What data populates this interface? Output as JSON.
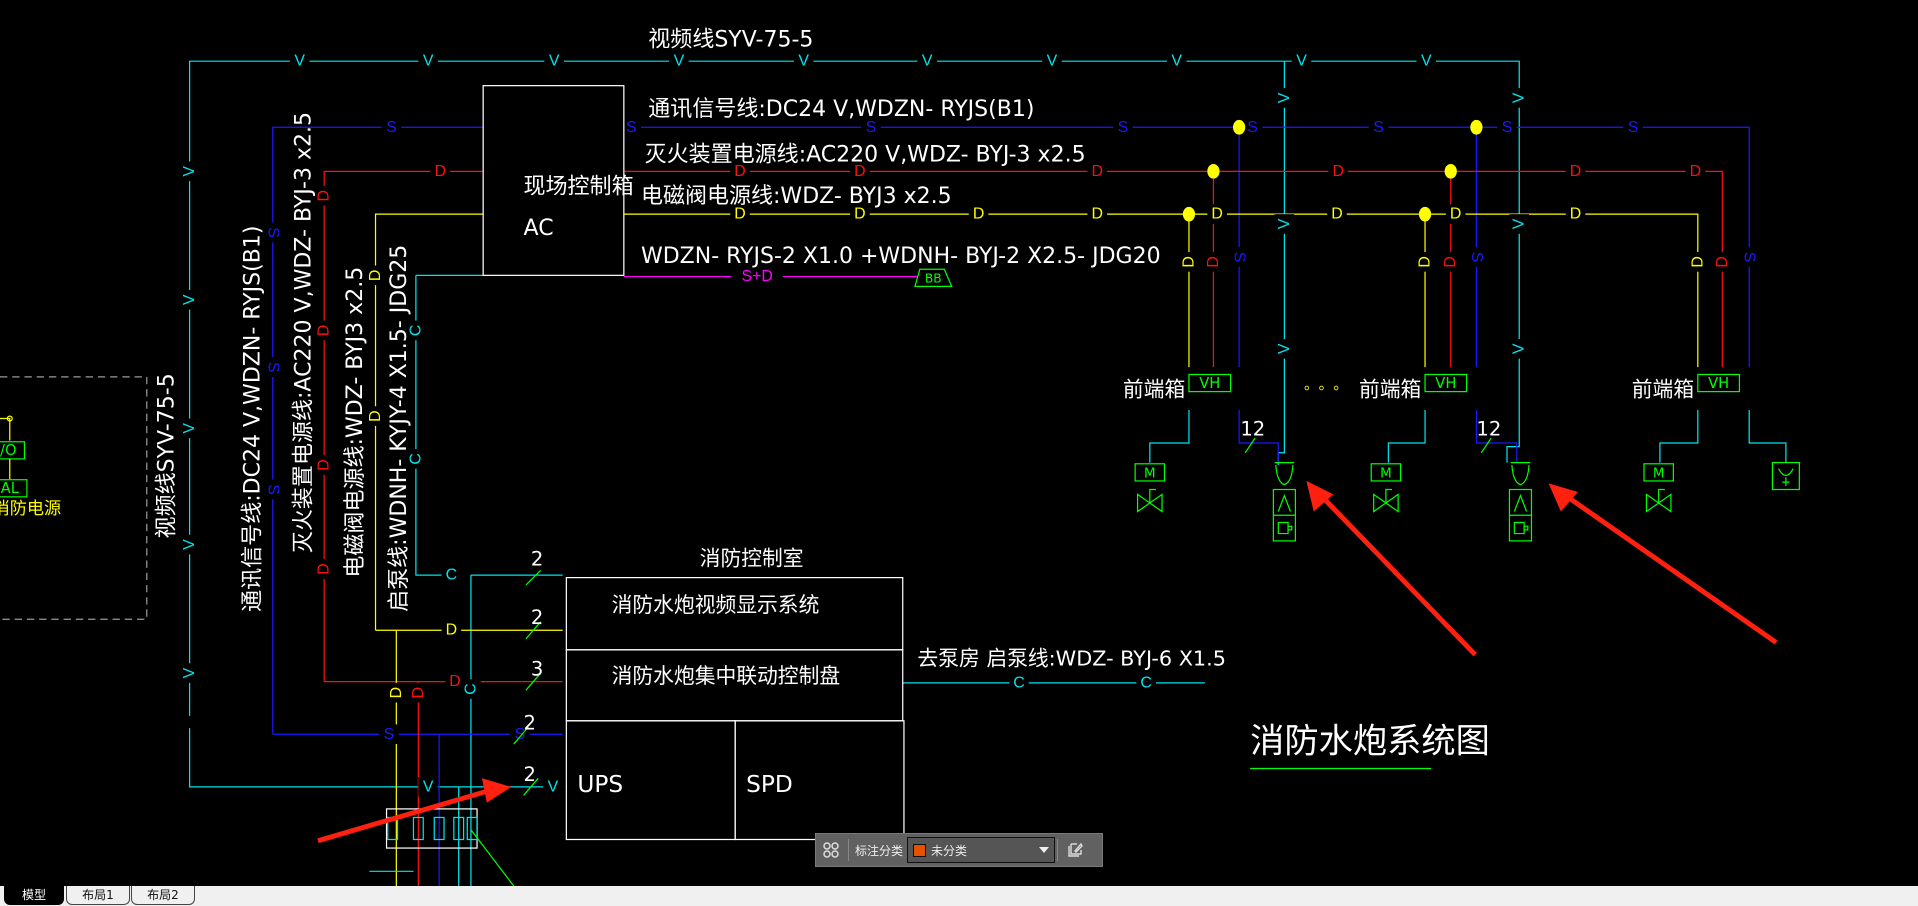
{
  "drawing": {
    "title": "消防水炮系统图",
    "colors": {
      "video": "#00e5ee",
      "signal": "#1a1aff",
      "power": "#ff1010",
      "valve_power": "#ffff00",
      "bus": "#ff00ff",
      "device": "#00ff00",
      "text": "#ffffff",
      "arrow": "#ff2010",
      "dashed": "#9a9a9a"
    },
    "line_markers": {
      "video": "V",
      "signal": "S",
      "power": "D",
      "pump": "C",
      "bus": "S+D"
    },
    "labels": {
      "video_top": "视频线SYV-75-5",
      "signal_top": "通讯信号线:DC24 V,WDZN- RYJS(B1)",
      "power_top": "灭火装置电源线:AC220 V,WDZ- BYJ-3 x2.5",
      "valve_top": "电磁阀电源线:WDZ- BYJ3 x2.5",
      "bus_top": "WDZN- RYJS-2 X1.0 +WDNH- BYJ-2 X2.5- JDG20",
      "video_vert": "视频线SYV-75-5",
      "signal_vert": "通讯信号线:DC24 V,WDZN- RYJS(B1)",
      "power_vert": "灭火装置电源线:AC220 V,WDZ- BYJ-3 x2.5",
      "valve_vert": "电磁阀电源线:WDZ- BYJ3 x2.5",
      "pump_vert": "启泵线:WDNH- KYJY-4 X1.5- JDG25",
      "pump_room": "去泵房  启泵线:WDZ- BYJ-6 X1.5",
      "junction_box_tag": "BB"
    },
    "field_control_box": {
      "name": "现场控制箱",
      "code": "AC"
    },
    "control_room": {
      "title": "消防控制室",
      "video_system": "消防水炮视频显示系统",
      "linkage_panel": "消防水炮集中联动控制盘",
      "ups": "UPS",
      "spd": "SPD"
    },
    "wire_counts": [
      "2",
      "2",
      "3",
      "2",
      "2"
    ],
    "front_end_units": [
      {
        "label": "前端箱",
        "box": "VH",
        "motor": "M",
        "count": "12",
        "has_cannon": true
      },
      {
        "label": "前端箱",
        "box": "VH",
        "motor": "M",
        "count": "12",
        "has_cannon": true
      },
      {
        "label": "前端箱",
        "box": "VH",
        "motor": "M",
        "count": "",
        "has_cannon": false
      }
    ],
    "ellipsis": "。。。",
    "left_panel": {
      "io_box": "I/O",
      "al_box": "AL",
      "caption": "消防电源"
    }
  },
  "annotation_toolbar": {
    "label": "标注分类",
    "selected": "未分类",
    "selected_color": "#e65100"
  },
  "layout_tabs": [
    {
      "label": "模型",
      "active": true
    },
    {
      "label": "布局1",
      "active": false
    },
    {
      "label": "布局2",
      "active": false
    }
  ]
}
